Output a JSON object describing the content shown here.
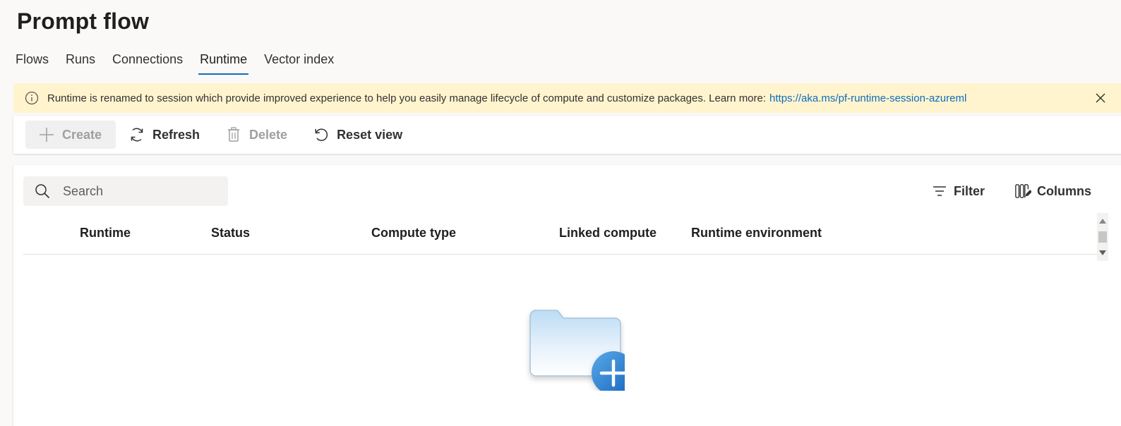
{
  "page": {
    "title": "Prompt flow"
  },
  "tabs": [
    {
      "label": "Flows"
    },
    {
      "label": "Runs"
    },
    {
      "label": "Connections"
    },
    {
      "label": "Runtime",
      "active": true
    },
    {
      "label": "Vector index"
    }
  ],
  "banner": {
    "icon": "info-icon",
    "message": "Runtime is renamed to session which provide improved experience to help you easily manage lifecycle of compute and customize packages. Learn more:",
    "link_text": "https://aka.ms/pf-runtime-session-azureml",
    "close_icon": "close-icon",
    "background": "#fff4ce"
  },
  "toolbar": {
    "create_label": "Create",
    "refresh_label": "Refresh",
    "delete_label": "Delete",
    "reset_view_label": "Reset view"
  },
  "search": {
    "placeholder": "Search",
    "value": ""
  },
  "actions": {
    "filter_label": "Filter",
    "columns_label": "Columns"
  },
  "table": {
    "columns": [
      "Runtime",
      "Status",
      "Compute type",
      "Linked compute",
      "Runtime environment"
    ],
    "rows": []
  },
  "empty_state": {
    "illustration": "folder-add-icon"
  },
  "colors": {
    "accent": "#0f6cbd",
    "disabled_text": "#a19f9d"
  }
}
